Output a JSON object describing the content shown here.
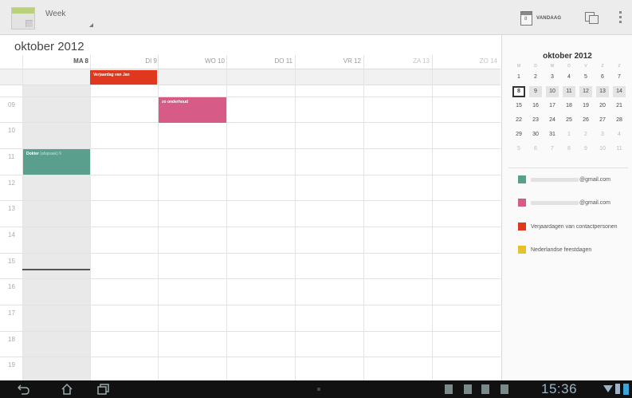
{
  "action_bar": {
    "view_label": "Week",
    "today_label": "VANDAAG",
    "today_icon_day": "8"
  },
  "header": {
    "month_title": "oktober 2012"
  },
  "days": [
    {
      "label": "MA 8",
      "state": "today"
    },
    {
      "label": "DI 9",
      "state": "normal"
    },
    {
      "label": "WO 10",
      "state": "normal"
    },
    {
      "label": "DO 11",
      "state": "normal"
    },
    {
      "label": "VR 12",
      "state": "normal"
    },
    {
      "label": "ZA 13",
      "state": "weekend"
    },
    {
      "label": "ZO 14",
      "state": "weekend"
    }
  ],
  "hours": [
    "09",
    "10",
    "11",
    "12",
    "13",
    "14",
    "15",
    "16",
    "17",
    "18",
    "19"
  ],
  "events": {
    "allday_birthday": "Verjaardag van Jan",
    "pink_event": "zo onderhoud",
    "teal_event": "Dokter",
    "teal_event_extra": "(afspraak) 9"
  },
  "mini_calendar": {
    "title": "oktober 2012",
    "dow": [
      "M",
      "D",
      "W",
      "D",
      "V",
      "Z",
      "Z"
    ],
    "weeks": [
      [
        "1",
        "2",
        "3",
        "4",
        "5",
        "6",
        "7"
      ],
      [
        "8",
        "9",
        "10",
        "11",
        "12",
        "13",
        "14"
      ],
      [
        "15",
        "16",
        "17",
        "18",
        "19",
        "20",
        "21"
      ],
      [
        "22",
        "23",
        "24",
        "25",
        "26",
        "27",
        "28"
      ],
      [
        "29",
        "30",
        "31",
        "1",
        "2",
        "3",
        "4"
      ],
      [
        "5",
        "6",
        "7",
        "8",
        "9",
        "10",
        "11"
      ]
    ]
  },
  "calendars": [
    {
      "label": "@gmail.com",
      "color": "#5a9e8e"
    },
    {
      "label": "@gmail.com",
      "color": "#d75b87"
    },
    {
      "label": "Verjaardagen van contactpersonen",
      "color": "#e0381e"
    },
    {
      "label": "Nederlandse feestdagen",
      "color": "#e6c12e"
    }
  ],
  "status_bar": {
    "time": "15:36"
  },
  "colors": {
    "accent_red": "#e0381e",
    "accent_pink": "#d75b87",
    "accent_teal": "#5a9e8e",
    "accent_yellow": "#e6c12e",
    "clock_blue": "#9bb4c7"
  }
}
